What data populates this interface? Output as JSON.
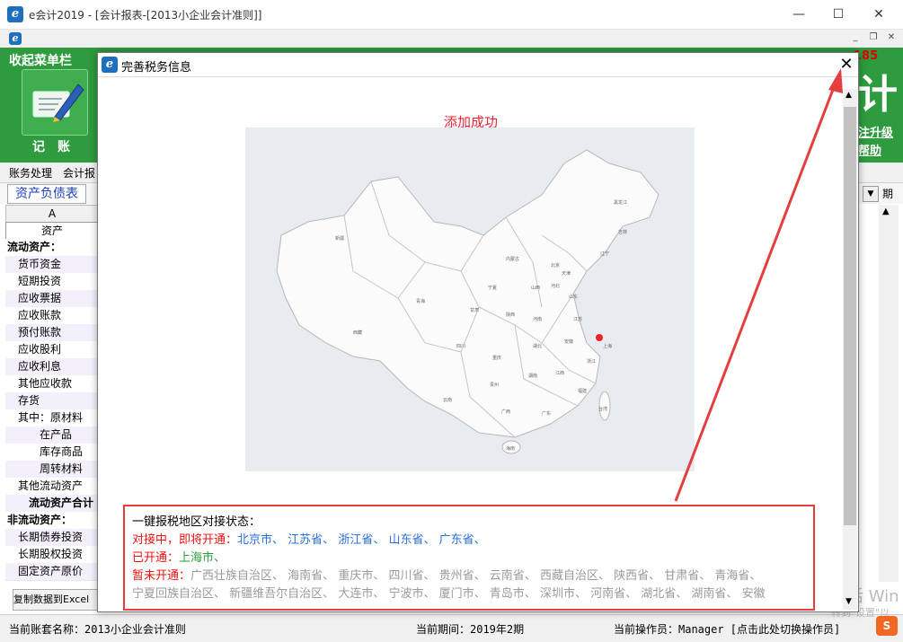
{
  "window": {
    "title": "e会计2019 - [会计报表-[2013小企业会计准则]]",
    "icon_letter": "e",
    "min": "—",
    "max": "☐",
    "close": "✕"
  },
  "menustrip": {
    "mdi_min": "_",
    "mdi_restore": "❐",
    "mdi_close": "✕"
  },
  "header": {
    "collapse_menu": "收起菜单栏",
    "bookkeep_label": "记账",
    "phone_fragment": "185",
    "upgrade": "注升级",
    "help": "帮助",
    "brand_glyph": "计"
  },
  "tabs1": [
    "账务处理",
    "会计报"
  ],
  "tabs2": {
    "active": "资产负债表",
    "right_label": "期"
  },
  "sheet": {
    "column_header": "A",
    "asset_header": "资产",
    "rows": [
      {
        "text": "流动资产：",
        "bold": true,
        "indent": 0
      },
      {
        "text": "货币资金",
        "bold": false,
        "indent": 1
      },
      {
        "text": "短期投资",
        "bold": false,
        "indent": 1
      },
      {
        "text": "应收票据",
        "bold": false,
        "indent": 1
      },
      {
        "text": "应收账款",
        "bold": false,
        "indent": 1
      },
      {
        "text": "预付账款",
        "bold": false,
        "indent": 1
      },
      {
        "text": "应收股利",
        "bold": false,
        "indent": 1
      },
      {
        "text": "应收利息",
        "bold": false,
        "indent": 1
      },
      {
        "text": "其他应收款",
        "bold": false,
        "indent": 1
      },
      {
        "text": "存货",
        "bold": false,
        "indent": 1
      },
      {
        "text": "其中：原材料",
        "bold": false,
        "indent": 1
      },
      {
        "text": "在产品",
        "bold": false,
        "indent": 3
      },
      {
        "text": "库存商品",
        "bold": false,
        "indent": 3
      },
      {
        "text": "周转材料",
        "bold": false,
        "indent": 3
      },
      {
        "text": "其他流动资产",
        "bold": false,
        "indent": 1
      },
      {
        "text": "流动资产合计",
        "bold": true,
        "indent": 2
      },
      {
        "text": "非流动资产：",
        "bold": true,
        "indent": 0
      },
      {
        "text": "长期债券投资",
        "bold": false,
        "indent": 1
      },
      {
        "text": "长期股权投资",
        "bold": false,
        "indent": 1
      },
      {
        "text": "固定资产原价",
        "bold": false,
        "indent": 1
      }
    ],
    "copy_button": "复制数据到Excel"
  },
  "statusbar": {
    "account": "当前账套名称：2013小企业会计准则",
    "period": "当前期间：2019年2期",
    "operator": "当前操作员：Manager [点击此处切换操作员]"
  },
  "dialog": {
    "title": "完善税务信息",
    "close": "✕",
    "success": "添加成功",
    "status_heading": "一键报税地区对接状态：",
    "connecting_label": "对接中，即将开通：",
    "connecting": [
      "北京市、",
      "江苏省、",
      "浙江省、",
      "山东省、",
      "广东省、"
    ],
    "open_label": "已开通：",
    "open": [
      "上海市、"
    ],
    "closed_label": "暂未开通：",
    "closed_line1": [
      "广西壮族自治区、",
      "海南省、",
      "重庆市、",
      "四川省、",
      "贵州省、",
      "云南省、",
      "西藏自治区、",
      "陕西省、",
      "甘肃省、",
      "青海省、"
    ],
    "closed_line2": [
      "宁夏回族自治区、",
      "新疆维吾尔自治区、",
      "大连市、",
      "宁波市、",
      "厦门市、",
      "青岛市、",
      "深圳市、",
      "河南省、",
      "湖北省、",
      "湖南省、",
      "安徽"
    ],
    "map_labels": [
      "黑龙江",
      "吉林",
      "辽宁",
      "内蒙古",
      "北京",
      "天津",
      "河北",
      "山西",
      "山东",
      "宁夏",
      "甘肃",
      "青海",
      "新疆",
      "西藏",
      "陕西",
      "河南",
      "江苏",
      "安徽",
      "上海",
      "湖北",
      "四川",
      "重庆",
      "浙江",
      "湖南",
      "江西",
      "贵州",
      "福建",
      "云南",
      "广西",
      "广东",
      "台湾",
      "海南"
    ],
    "map_marker_label": "上海"
  },
  "watermark": {
    "line1": "激活 Win",
    "line2": "转到\"设置\"以"
  },
  "ime": "S",
  "colors": {
    "green": "#2e9b3e",
    "annotation_red": "#e53e3e",
    "link_blue": "#2a6fd6"
  }
}
